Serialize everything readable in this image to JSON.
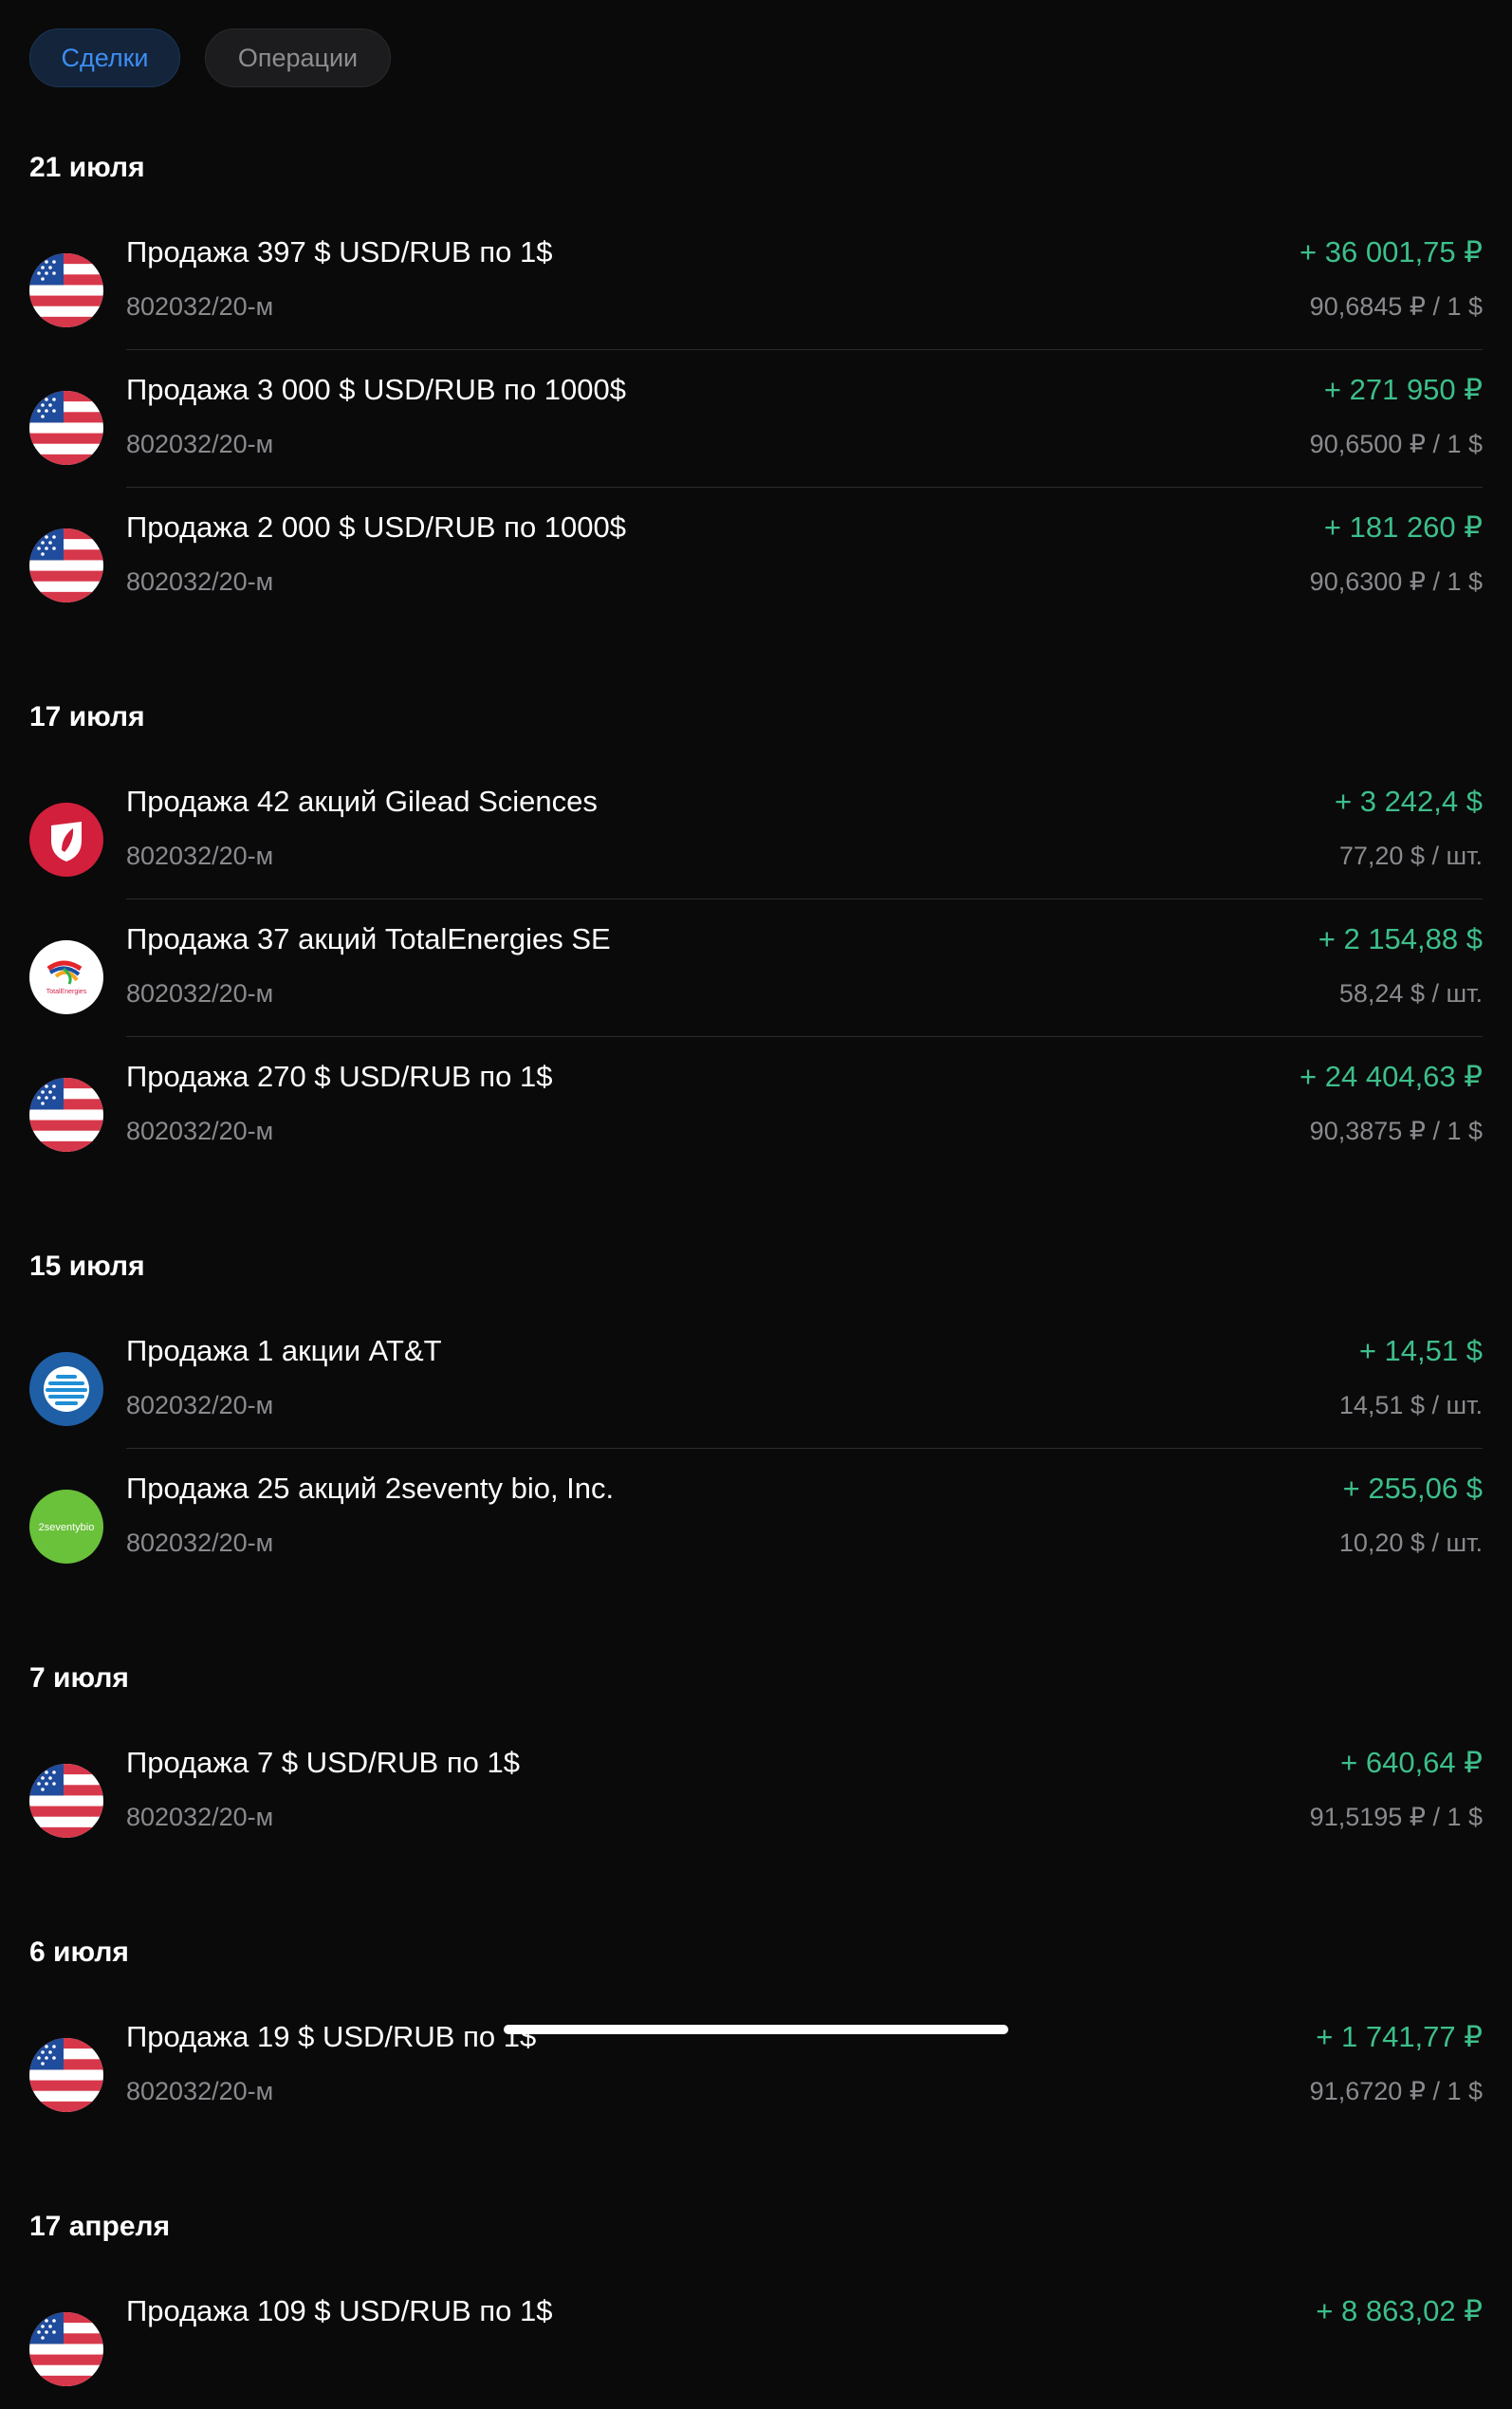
{
  "tabs": {
    "deals": "Сделки",
    "operations": "Операции"
  },
  "colors": {
    "positive": "#3dbf8a",
    "accent": "#3d8ef2",
    "secondary_text": "#8a8a8e"
  },
  "groups": [
    {
      "date": "21 июля",
      "items": [
        {
          "logo": "usa-flag-icon",
          "title": "Продажа 397 $ USD/RUB по 1$",
          "account": "802032/20-м",
          "amount": "+ 36 001,75 ₽",
          "rate": "90,6845 ₽ / 1 $"
        },
        {
          "logo": "usa-flag-icon",
          "title": "Продажа 3 000 $ USD/RUB по 1000$",
          "account": "802032/20-м",
          "amount": "+ 271 950 ₽",
          "rate": "90,6500 ₽ / 1 $"
        },
        {
          "logo": "usa-flag-icon",
          "title": "Продажа 2 000 $ USD/RUB по 1000$",
          "account": "802032/20-м",
          "amount": "+ 181 260 ₽",
          "rate": "90,6300 ₽ / 1 $"
        }
      ]
    },
    {
      "date": "17 июля",
      "items": [
        {
          "logo": "gilead-logo-icon",
          "title": "Продажа 42 акций Gilead Sciences",
          "account": "802032/20-м",
          "amount": "+ 3 242,4 $",
          "rate": "77,20 $ / шт."
        },
        {
          "logo": "totalenergies-logo-icon",
          "title": "Продажа 37 акций TotalEnergies SE",
          "account": "802032/20-м",
          "amount": "+ 2 154,88 $",
          "rate": "58,24 $ / шт."
        },
        {
          "logo": "usa-flag-icon",
          "title": "Продажа 270 $ USD/RUB по 1$",
          "account": "802032/20-м",
          "amount": "+ 24 404,63 ₽",
          "rate": "90,3875 ₽ / 1 $"
        }
      ]
    },
    {
      "date": "15 июля",
      "items": [
        {
          "logo": "att-logo-icon",
          "title": "Продажа 1 акции AT&T",
          "account": "802032/20-м",
          "amount": "+ 14,51 $",
          "rate": "14,51 $ / шт."
        },
        {
          "logo": "2seventy-logo-icon",
          "title": "Продажа 25 акций 2seventy bio, Inc.",
          "account": "802032/20-м",
          "amount": "+ 255,06 $",
          "rate": "10,20 $ / шт."
        }
      ]
    },
    {
      "date": "7 июля",
      "items": [
        {
          "logo": "usa-flag-icon",
          "title": "Продажа 7 $ USD/RUB по 1$",
          "account": "802032/20-м",
          "amount": "+ 640,64 ₽",
          "rate": "91,5195 ₽ / 1 $"
        }
      ]
    },
    {
      "date": "6 июля",
      "items": [
        {
          "logo": "usa-flag-icon",
          "title": "Продажа 19 $ USD/RUB по 1$",
          "account": "802032/20-м",
          "amount": "+ 1 741,77 ₽",
          "rate": "91,6720 ₽ / 1 $"
        }
      ]
    },
    {
      "date": "17 апреля",
      "items": [
        {
          "logo": "usa-flag-icon",
          "title": "Продажа 109 $ USD/RUB по 1$",
          "account": "",
          "amount": "+ 8 863,02 ₽",
          "rate": ""
        }
      ]
    }
  ],
  "logo_texts": {
    "totalenergies": "TotalEnergies",
    "twoseventy": "2seventybio"
  }
}
